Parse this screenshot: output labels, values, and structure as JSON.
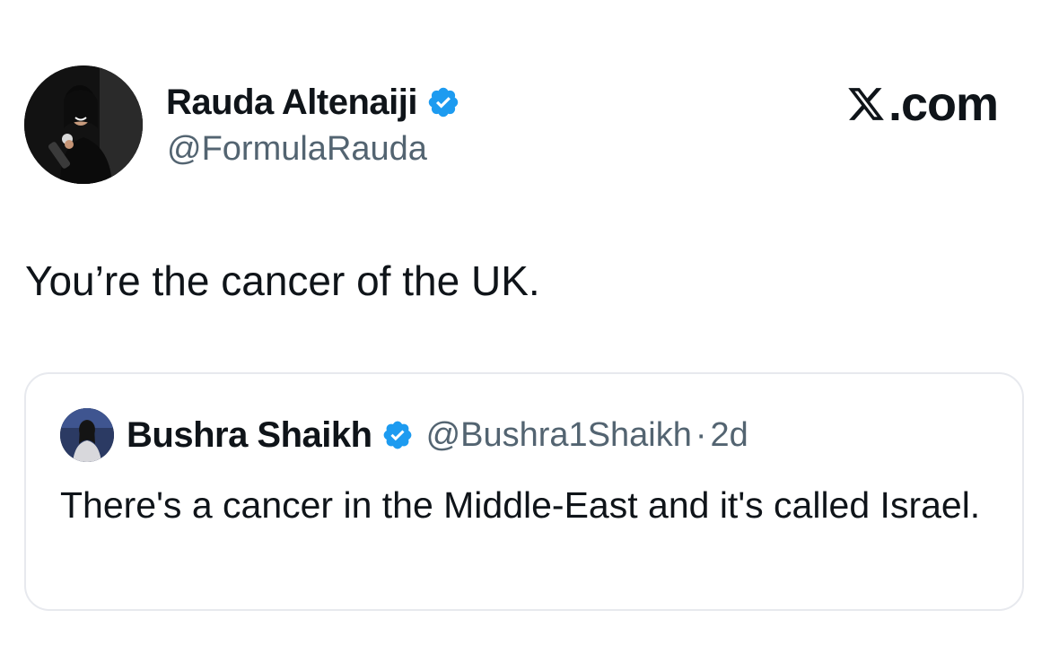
{
  "brand": {
    "logo_letter_icon": "x-logo-icon",
    "suffix": ".com"
  },
  "author": {
    "name": "Rauda Altenaiji",
    "handle": "@FormulaRauda",
    "verified": true,
    "avatar_icon": "avatar-rauda"
  },
  "tweet": {
    "text": "You’re the cancer of the UK."
  },
  "quote": {
    "name": "Bushra Shaikh",
    "handle": "@Bushra1Shaikh",
    "separator": "·",
    "time": "2d",
    "verified": true,
    "avatar_icon": "avatar-bushra",
    "text": "There's a cancer in the Middle-East and it's called Israel."
  },
  "colors": {
    "verified_blue": "#1d9bf0",
    "text_primary": "#0f1419",
    "text_secondary": "#536471",
    "card_border": "#e7e9ee"
  }
}
